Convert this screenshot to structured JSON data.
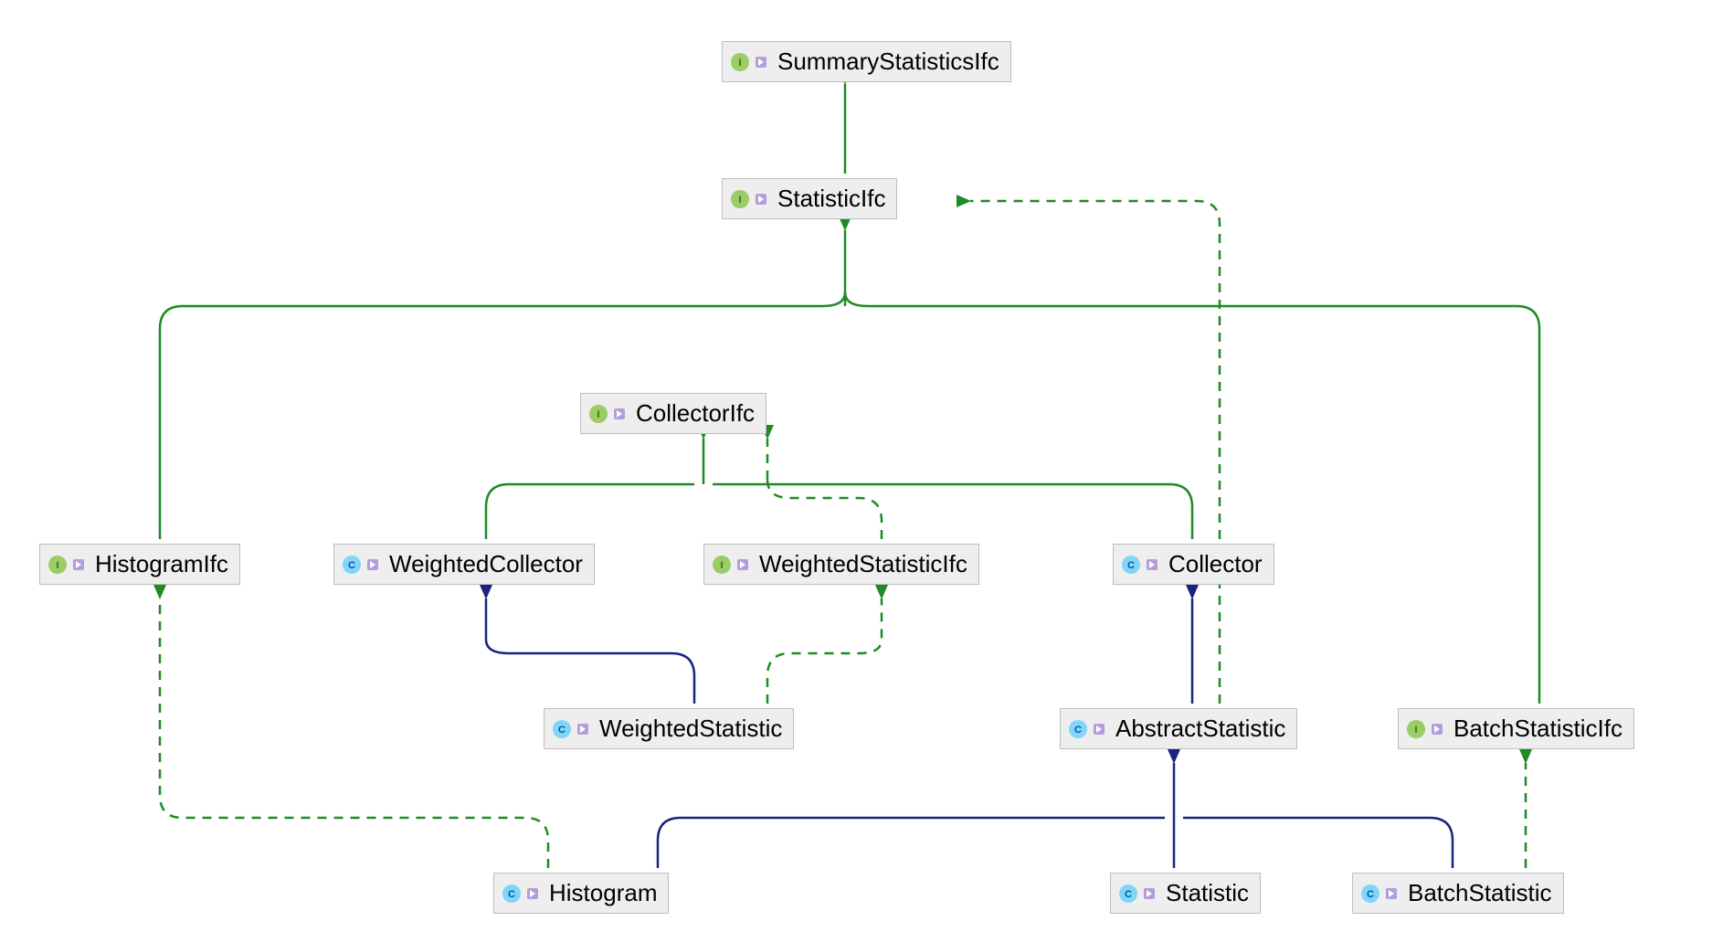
{
  "diagram": {
    "nodes": {
      "summaryStatisticsIfc": {
        "label": "SummaryStatisticsIfc",
        "type": "interface"
      },
      "statisticIfc": {
        "label": "StatisticIfc",
        "type": "interface"
      },
      "collectorIfc": {
        "label": "CollectorIfc",
        "type": "interface"
      },
      "histogramIfc": {
        "label": "HistogramIfc",
        "type": "interface"
      },
      "weightedCollector": {
        "label": "WeightedCollector",
        "type": "class"
      },
      "weightedStatisticIfc": {
        "label": "WeightedStatisticIfc",
        "type": "interface"
      },
      "collector": {
        "label": "Collector",
        "type": "class"
      },
      "weightedStatistic": {
        "label": "WeightedStatistic",
        "type": "class"
      },
      "abstractStatistic": {
        "label": "AbstractStatistic",
        "type": "class"
      },
      "batchStatisticIfc": {
        "label": "BatchStatisticIfc",
        "type": "interface"
      },
      "histogram": {
        "label": "Histogram",
        "type": "class"
      },
      "statistic": {
        "label": "Statistic",
        "type": "class"
      },
      "batchStatistic": {
        "label": "BatchStatistic",
        "type": "class"
      }
    },
    "edges": [
      {
        "from": "statisticIfc",
        "to": "summaryStatisticsIfc",
        "kind": "extends",
        "style": "solid"
      },
      {
        "from": "histogramIfc",
        "to": "statisticIfc",
        "kind": "extends",
        "style": "solid"
      },
      {
        "from": "batchStatisticIfc",
        "to": "statisticIfc",
        "kind": "extends",
        "style": "solid"
      },
      {
        "from": "weightedCollector",
        "to": "collectorIfc",
        "kind": "implements",
        "style": "solid"
      },
      {
        "from": "collector",
        "to": "collectorIfc",
        "kind": "implements",
        "style": "solid"
      },
      {
        "from": "weightedStatistic",
        "to": "weightedCollector",
        "kind": "extends-class",
        "style": "solid"
      },
      {
        "from": "weightedStatistic",
        "to": "weightedStatisticIfc",
        "kind": "implements",
        "style": "dashed"
      },
      {
        "from": "weightedStatisticIfc",
        "to": "collectorIfc",
        "kind": "extends",
        "style": "dashed"
      },
      {
        "from": "abstractStatistic",
        "to": "collector",
        "kind": "extends-class",
        "style": "solid"
      },
      {
        "from": "abstractStatistic",
        "to": "statisticIfc",
        "kind": "implements",
        "style": "dashed"
      },
      {
        "from": "histogram",
        "to": "abstractStatistic",
        "kind": "extends-class",
        "style": "solid"
      },
      {
        "from": "statistic",
        "to": "abstractStatistic",
        "kind": "extends-class",
        "style": "solid"
      },
      {
        "from": "batchStatistic",
        "to": "abstractStatistic",
        "kind": "extends-class",
        "style": "solid"
      },
      {
        "from": "histogram",
        "to": "histogramIfc",
        "kind": "implements",
        "style": "dashed"
      },
      {
        "from": "batchStatistic",
        "to": "batchStatisticIfc",
        "kind": "implements",
        "style": "dashed"
      }
    ],
    "colors": {
      "interfaceEdge": "#1f8b24",
      "classEdge": "#1a237e"
    }
  }
}
